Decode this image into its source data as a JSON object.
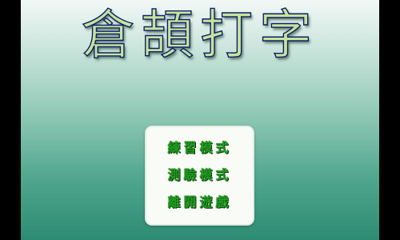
{
  "title": "倉頡打字",
  "menu": {
    "items": [
      {
        "label": "練習模式"
      },
      {
        "label": "測驗模式"
      },
      {
        "label": "離開遊戲"
      }
    ]
  },
  "colors": {
    "background_top": "#f2f8f6",
    "background_bottom": "#2e8b73",
    "title_fill": "#c8e39a",
    "title_outline": "#0d1f6a",
    "menu_text": "#1f9d1f",
    "menu_panel": "#f8fbf6"
  }
}
